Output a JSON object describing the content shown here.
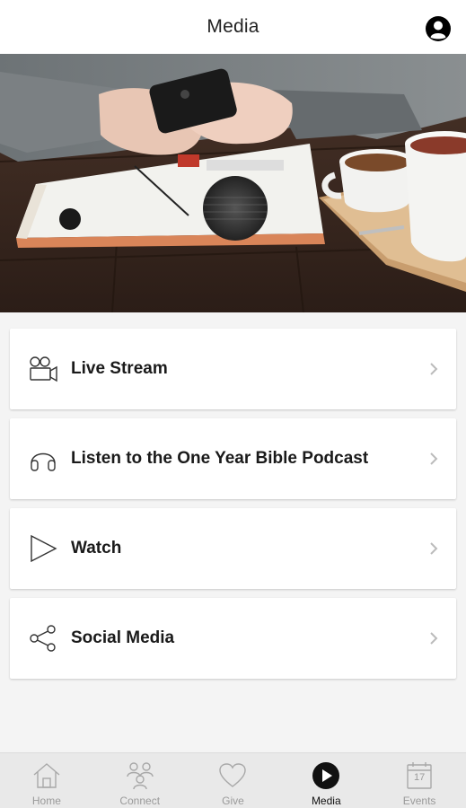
{
  "header": {
    "title": "Media",
    "profile_icon": "user-circle-icon"
  },
  "hero": {
    "image_description": "hands-with-phone-coffee-magazine-photo"
  },
  "menu": {
    "items": [
      {
        "label": "Live Stream",
        "icon": "video-camera-icon"
      },
      {
        "label": "Listen to the One Year Bible Podcast",
        "icon": "headphones-icon"
      },
      {
        "label": "Watch",
        "icon": "play-outline-icon"
      },
      {
        "label": "Social Media",
        "icon": "share-icon"
      }
    ]
  },
  "tabbar": {
    "tabs": [
      {
        "label": "Home",
        "icon": "home-icon",
        "active": false
      },
      {
        "label": "Connect",
        "icon": "people-icon",
        "active": false
      },
      {
        "label": "Give",
        "icon": "heart-icon",
        "active": false
      },
      {
        "label": "Media",
        "icon": "play-circle-icon",
        "active": true
      },
      {
        "label": "Events",
        "icon": "calendar-icon",
        "active": false
      }
    ],
    "calendar_day": "17"
  },
  "colors": {
    "background": "#f4f4f4",
    "card": "#ffffff",
    "tabbar": "#e9e9e9",
    "active_tab": "#111111",
    "inactive_tab": "#9a9a9a"
  }
}
